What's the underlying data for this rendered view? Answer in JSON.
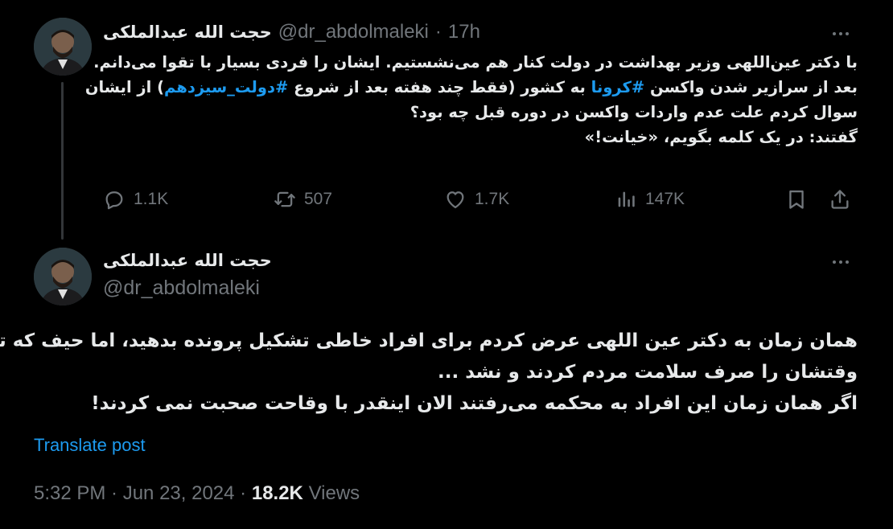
{
  "tweet1": {
    "author_name": "حجت الله عبدالملکی",
    "handle": "@dr_abdolmaleki",
    "separator": "·",
    "time": "17h",
    "lines": [
      {
        "parts": [
          {
            "text": "با دکتر عین‌اللهی وزیر بهداشت در دولت کنار هم می‌نشستیم. ایشان را فردی بسیار با تقوا می‌دانم.",
            "hashtag": false
          }
        ]
      },
      {
        "parts": [
          {
            "text": "بعد از سرازیر شدن واکسن ",
            "hashtag": false
          },
          {
            "text": "#کرونا",
            "hashtag": true
          },
          {
            "text": " به کشور (فقط چند هفته بعد از شروع ",
            "hashtag": false
          },
          {
            "text": "#دولت_سیزدهم",
            "hashtag": true
          },
          {
            "text": ") از ایشان",
            "hashtag": false
          }
        ]
      },
      {
        "parts": [
          {
            "text": "سوال کردم علت عدم واردات واکسن در دوره قبل چه بود؟",
            "hashtag": false
          }
        ]
      },
      {
        "parts": [
          {
            "text": "گفتند: در یک کلمه بگویم، «خیانت!»",
            "hashtag": false
          }
        ]
      }
    ],
    "actions": {
      "replies": "1.1K",
      "reposts": "507",
      "likes": "1.7K",
      "views": "147K"
    }
  },
  "tweet2": {
    "author_name": "حجت الله عبدالملکی",
    "handle": "@dr_abdolmaleki",
    "lines": [
      "همان زمان به دکتر عین اللهی عرض کردم برای افراد خاطی تشکیل پرونده بدهید، اما حیف که تمام",
      "وقتشان را صرف سلامت مردم کردند و نشد ...",
      "اگر همان زمان این افراد به محکمه می‌رفتند الان اینقدر با وقاحت صحبت نمی کردند!"
    ],
    "translate_label": "Translate post",
    "timestamp": "5:32 PM · Jun 23, 2024",
    "meta_separator": "·",
    "views_count": "18.2K",
    "views_label": "Views"
  },
  "colors": {
    "background": "#000000",
    "text": "#e7e9ea",
    "muted": "#71767b",
    "accent": "#1d9bf0",
    "divider": "#333639"
  },
  "icons": {
    "reply": "reply-icon",
    "repost": "repost-icon",
    "like": "heart-icon",
    "views": "views-icon",
    "bookmark": "bookmark-icon",
    "share": "share-icon",
    "more": "more-icon",
    "avatar": "avatar"
  }
}
